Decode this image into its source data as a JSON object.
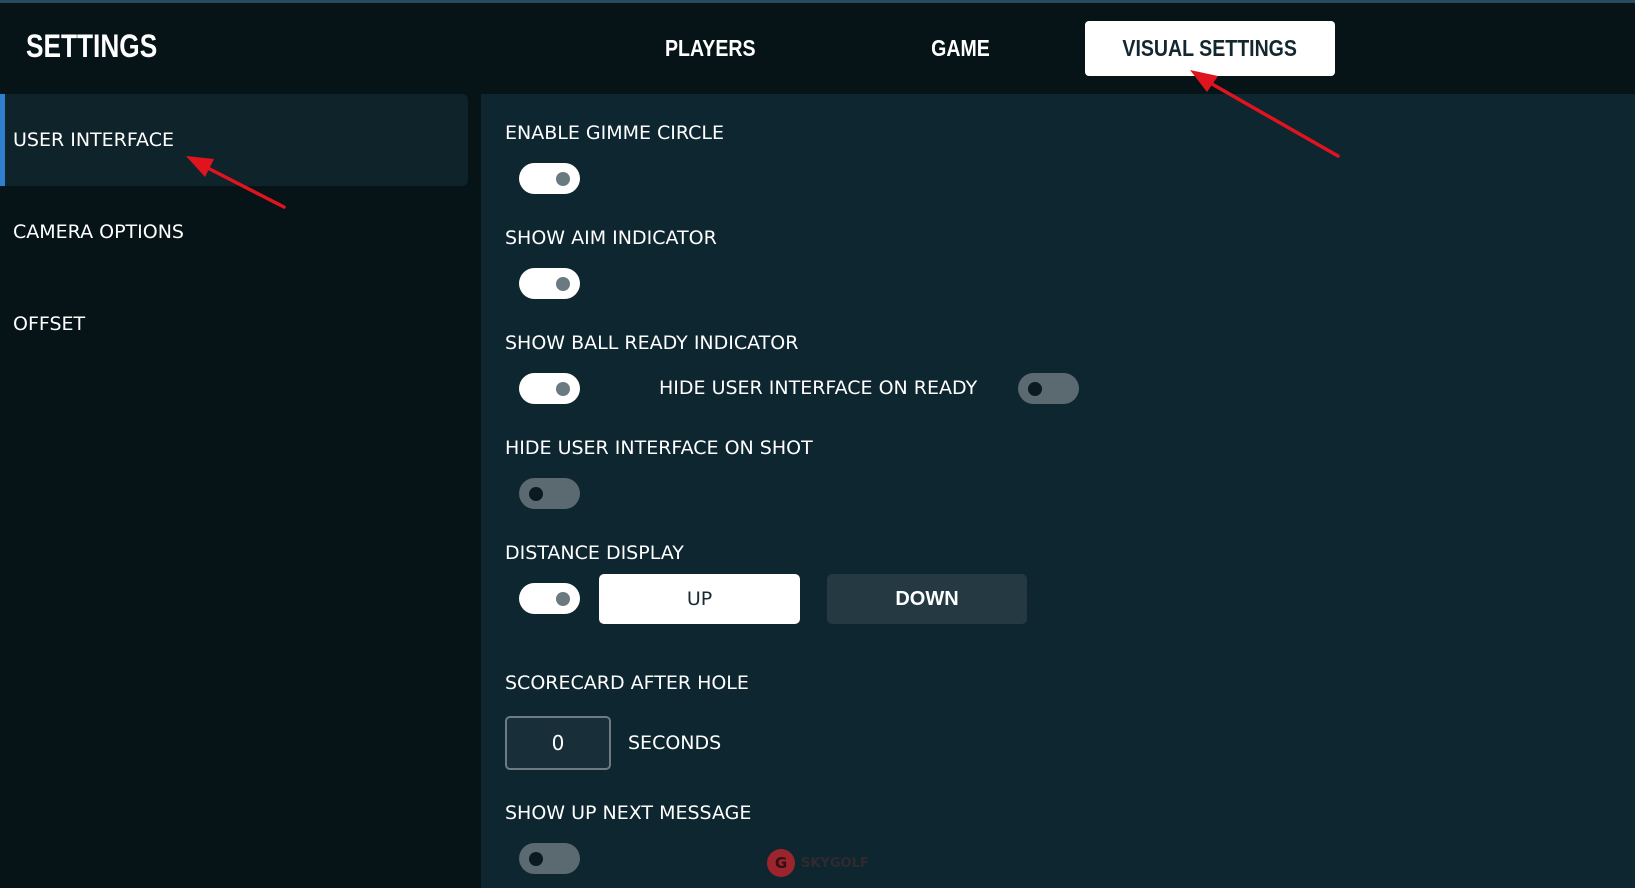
{
  "header": {
    "title": "SETTINGS",
    "tabs": [
      {
        "label": "PLAYERS",
        "active": false
      },
      {
        "label": "GAME",
        "active": false
      },
      {
        "label": "VISUAL SETTINGS",
        "active": true
      }
    ]
  },
  "sidebar": {
    "items": [
      {
        "label": "USER INTERFACE",
        "active": true
      },
      {
        "label": "CAMERA OPTIONS",
        "active": false
      },
      {
        "label": "OFFSET",
        "active": false
      }
    ]
  },
  "settings": {
    "gimme_circle": {
      "label": "ENABLE GIMME CIRCLE",
      "enabled": true
    },
    "aim_indicator": {
      "label": "SHOW AIM INDICATOR",
      "enabled": true
    },
    "ball_ready_indicator": {
      "label": "SHOW BALL READY INDICATOR",
      "enabled": true
    },
    "hide_ui_on_ready": {
      "label": "HIDE USER INTERFACE ON READY",
      "enabled": false
    },
    "hide_ui_on_shot": {
      "label": "HIDE USER INTERFACE ON SHOT",
      "enabled": false
    },
    "distance_display": {
      "label": "DISTANCE DISPLAY",
      "enabled": true,
      "options": [
        "UP",
        "DOWN"
      ],
      "selected": "UP"
    },
    "scorecard_after_hole": {
      "label": "SCORECARD AFTER HOLE",
      "value": "0",
      "unit": "SECONDS"
    },
    "up_next_message": {
      "label": "SHOW UP NEXT MESSAGE",
      "enabled": false
    }
  },
  "watermark": {
    "logo_letter": "G",
    "text": "SKYGOLF"
  },
  "colors": {
    "page_bg": "#061418",
    "panel_bg": "#0e2630",
    "sidebar_active_bg": "#0f232b",
    "accent": "#2e7fd0",
    "annotation_arrow": "#e0141e"
  }
}
